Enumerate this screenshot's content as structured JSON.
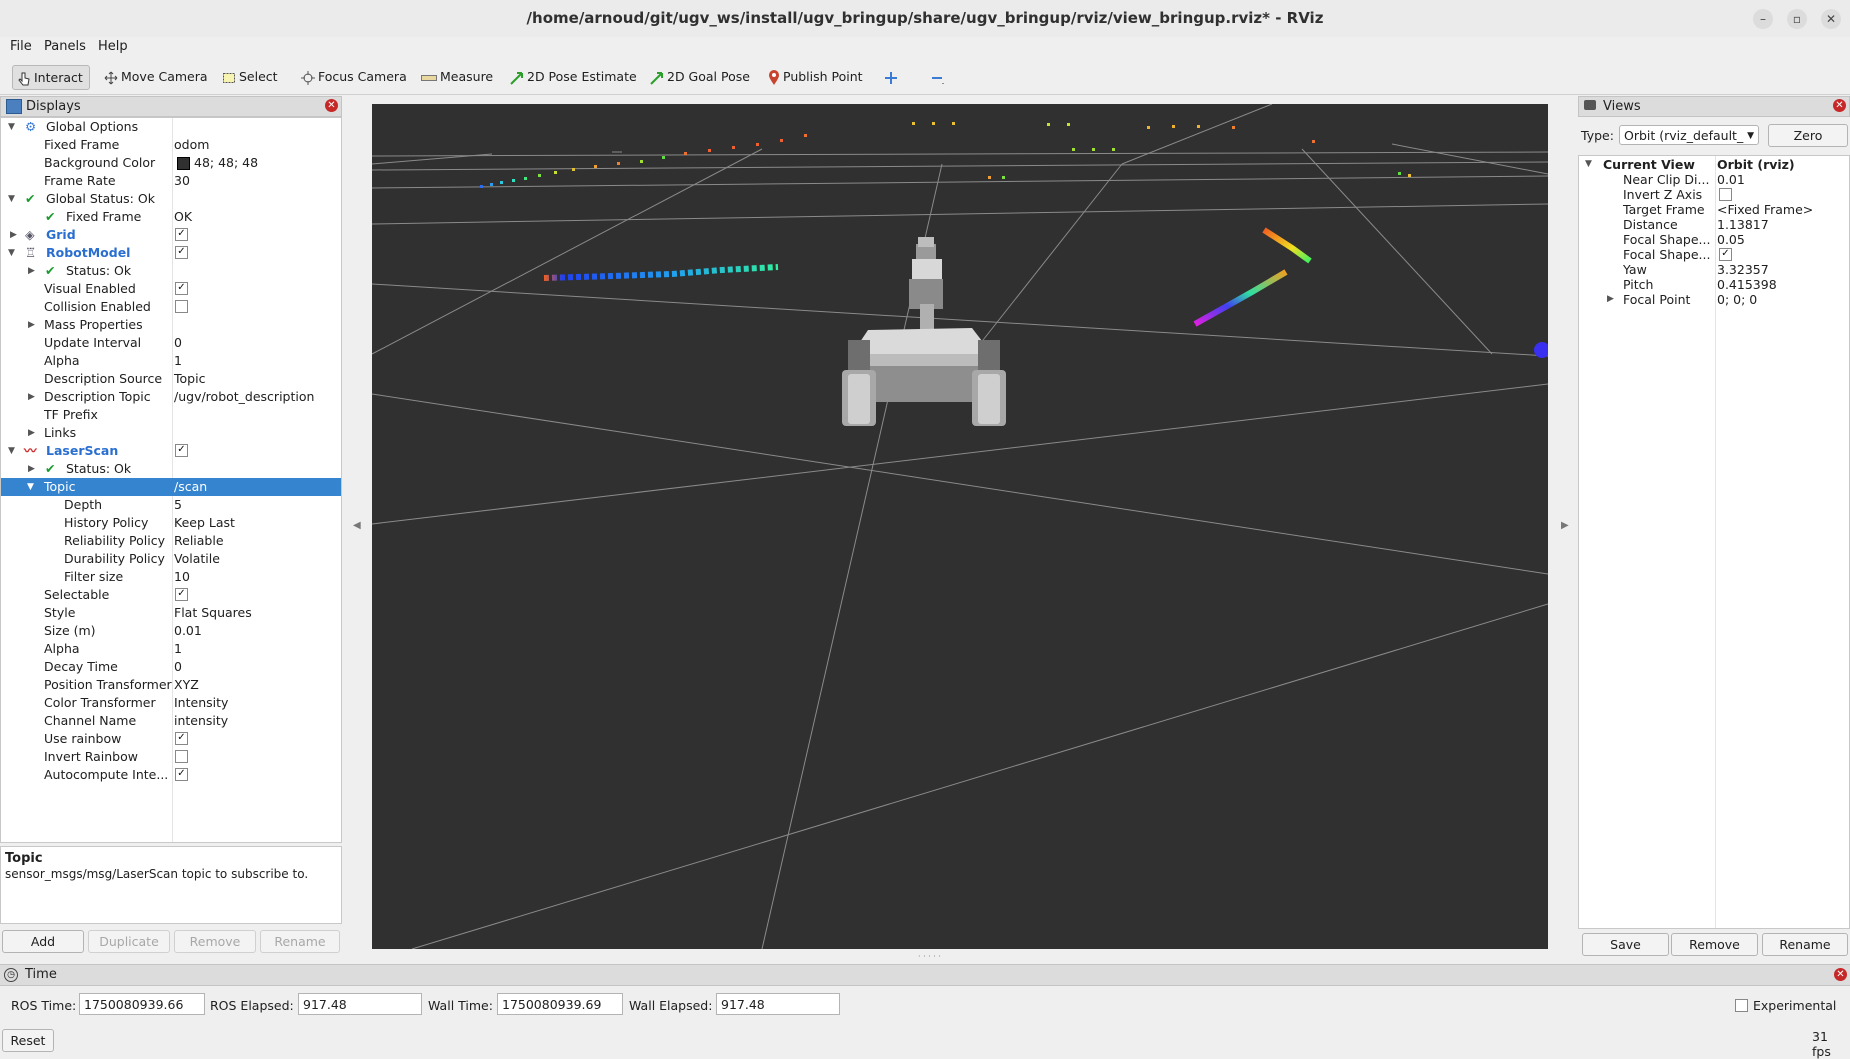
{
  "window": {
    "title": "/home/arnoud/git/ugv_ws/install/ugv_bringup/share/ugv_bringup/rviz/view_bringup.rviz* - RViz"
  },
  "menubar": {
    "file": "File",
    "panels": "Panels",
    "help": "Help"
  },
  "toolbar": {
    "interact": "Interact",
    "move_camera": "Move Camera",
    "select": "Select",
    "focus_camera": "Focus Camera",
    "measure": "Measure",
    "pose_estimate": "2D Pose Estimate",
    "goal_pose": "2D Goal Pose",
    "publish_point": "Publish Point"
  },
  "displays": {
    "title": "Displays",
    "rows": [
      {
        "label": "Global Options",
        "value": ""
      },
      {
        "label": "Fixed Frame",
        "value": "odom"
      },
      {
        "label": "Background Color",
        "value": "48; 48; 48"
      },
      {
        "label": "Frame Rate",
        "value": "30"
      },
      {
        "label": "Global Status: Ok",
        "value": ""
      },
      {
        "label": "Fixed Frame",
        "value": "OK"
      },
      {
        "label": "Grid",
        "value": ""
      },
      {
        "label": "RobotModel",
        "value": ""
      },
      {
        "label": "Status: Ok",
        "value": ""
      },
      {
        "label": "Visual Enabled",
        "value": ""
      },
      {
        "label": "Collision Enabled",
        "value": ""
      },
      {
        "label": "Mass Properties",
        "value": ""
      },
      {
        "label": "Update Interval",
        "value": "0"
      },
      {
        "label": "Alpha",
        "value": "1"
      },
      {
        "label": "Description Source",
        "value": "Topic"
      },
      {
        "label": "Description Topic",
        "value": "/ugv/robot_description"
      },
      {
        "label": "TF Prefix",
        "value": ""
      },
      {
        "label": "Links",
        "value": ""
      },
      {
        "label": "LaserScan",
        "value": ""
      },
      {
        "label": "Status: Ok",
        "value": ""
      },
      {
        "label": "Topic",
        "value": "/scan"
      },
      {
        "label": "Depth",
        "value": "5"
      },
      {
        "label": "History Policy",
        "value": "Keep Last"
      },
      {
        "label": "Reliability Policy",
        "value": "Reliable"
      },
      {
        "label": "Durability Policy",
        "value": "Volatile"
      },
      {
        "label": "Filter size",
        "value": "10"
      },
      {
        "label": "Selectable",
        "value": ""
      },
      {
        "label": "Style",
        "value": "Flat Squares"
      },
      {
        "label": "Size (m)",
        "value": "0.01"
      },
      {
        "label": "Alpha",
        "value": "1"
      },
      {
        "label": "Decay Time",
        "value": "0"
      },
      {
        "label": "Position Transformer",
        "value": "XYZ"
      },
      {
        "label": "Color Transformer",
        "value": "Intensity"
      },
      {
        "label": "Channel Name",
        "value": "intensity"
      },
      {
        "label": "Use rainbow",
        "value": ""
      },
      {
        "label": "Invert Rainbow",
        "value": ""
      },
      {
        "label": "Autocompute Inte...",
        "value": ""
      }
    ],
    "description": {
      "title": "Topic",
      "text": "sensor_msgs/msg/LaserScan topic to subscribe to."
    },
    "buttons": {
      "add": "Add",
      "duplicate": "Duplicate",
      "remove": "Remove",
      "rename": "Rename"
    }
  },
  "views": {
    "title": "Views",
    "type_label": "Type:",
    "type_value": "Orbit (rviz_default_",
    "zero": "Zero",
    "header": {
      "label": "Current View",
      "value": "Orbit (rviz)"
    },
    "rows": [
      {
        "label": "Near Clip Di...",
        "value": "0.01"
      },
      {
        "label": "Invert Z Axis",
        "value": ""
      },
      {
        "label": "Target Frame",
        "value": "<Fixed Frame>"
      },
      {
        "label": "Distance",
        "value": "1.13817"
      },
      {
        "label": "Focal Shape...",
        "value": "0.05"
      },
      {
        "label": "Focal Shape...",
        "value": ""
      },
      {
        "label": "Yaw",
        "value": "3.32357"
      },
      {
        "label": "Pitch",
        "value": "0.415398"
      },
      {
        "label": "Focal Point",
        "value": "0; 0; 0"
      }
    ],
    "buttons": {
      "save": "Save",
      "remove": "Remove",
      "rename": "Rename"
    }
  },
  "time": {
    "title": "Time",
    "ros_time_label": "ROS Time:",
    "ros_time": "1750080939.66",
    "ros_elapsed_label": "ROS Elapsed:",
    "ros_elapsed": "917.48",
    "wall_time_label": "Wall Time:",
    "wall_time": "1750080939.69",
    "wall_elapsed_label": "Wall Elapsed:",
    "wall_elapsed": "917.48",
    "experimental": "Experimental",
    "reset": "Reset",
    "fps": "31 fps"
  },
  "colors": {
    "background": "#303030",
    "selection": "#3584cf",
    "display_name": "#2a6fd0"
  }
}
